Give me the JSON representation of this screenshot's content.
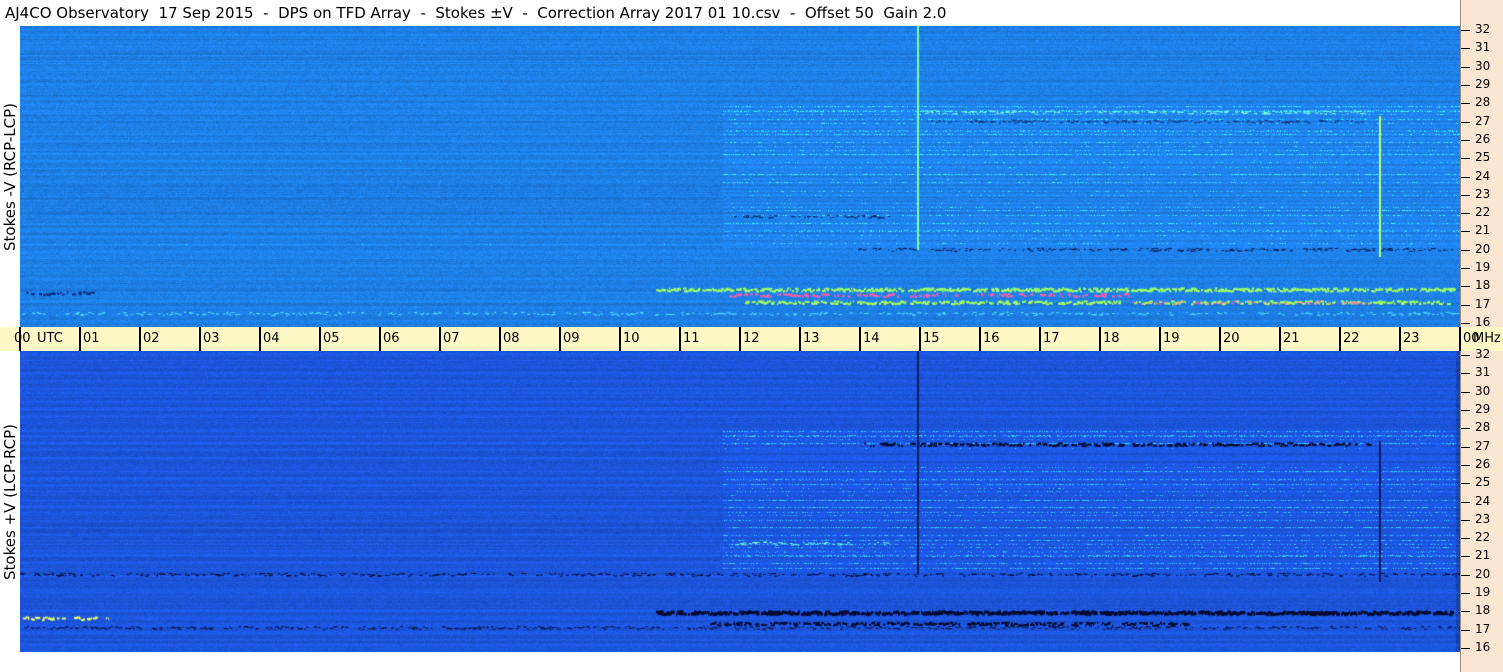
{
  "header": {
    "title": "AJ4CO Observatory  17 Sep 2015  -  DPS on TFD Array  -  Stokes ±V  -  Correction Array 2017 01 10.csv  -  Offset 50  Gain 2.0"
  },
  "chart_data": [
    {
      "type": "heatmap",
      "ylabel": "Stokes -V (RCP-LCP)",
      "x_ticks": [
        "00",
        "01",
        "02",
        "03",
        "04",
        "05",
        "06",
        "07",
        "08",
        "09",
        "10",
        "11",
        "12",
        "13",
        "14",
        "15",
        "16",
        "17",
        "18",
        "19",
        "20",
        "21",
        "22",
        "23",
        "00"
      ],
      "x_unit_label": "UTC",
      "x_end_unit": "MHz",
      "y_ticks": [
        32,
        31,
        30,
        29,
        28,
        27,
        26,
        25,
        24,
        23,
        22,
        21,
        20,
        19,
        18,
        17,
        16
      ],
      "ylim": [
        16,
        32
      ],
      "xlim": [
        0,
        24
      ],
      "colors": {
        "base": "#1e7fe6",
        "bright": "#37c8ff",
        "hot": "#ff4fa0"
      }
    },
    {
      "type": "heatmap",
      "ylabel": "Stokes +V (LCP-RCP)",
      "y_ticks": [
        32,
        31,
        30,
        29,
        28,
        27,
        26,
        25,
        24,
        23,
        22,
        21,
        20,
        19,
        18,
        17,
        16
      ],
      "ylim": [
        16,
        32
      ],
      "xlim": [
        0,
        24
      ],
      "colors": {
        "base": "#1c55dc",
        "bright": "#2fa8f5",
        "dark": "#0a1446"
      }
    }
  ]
}
